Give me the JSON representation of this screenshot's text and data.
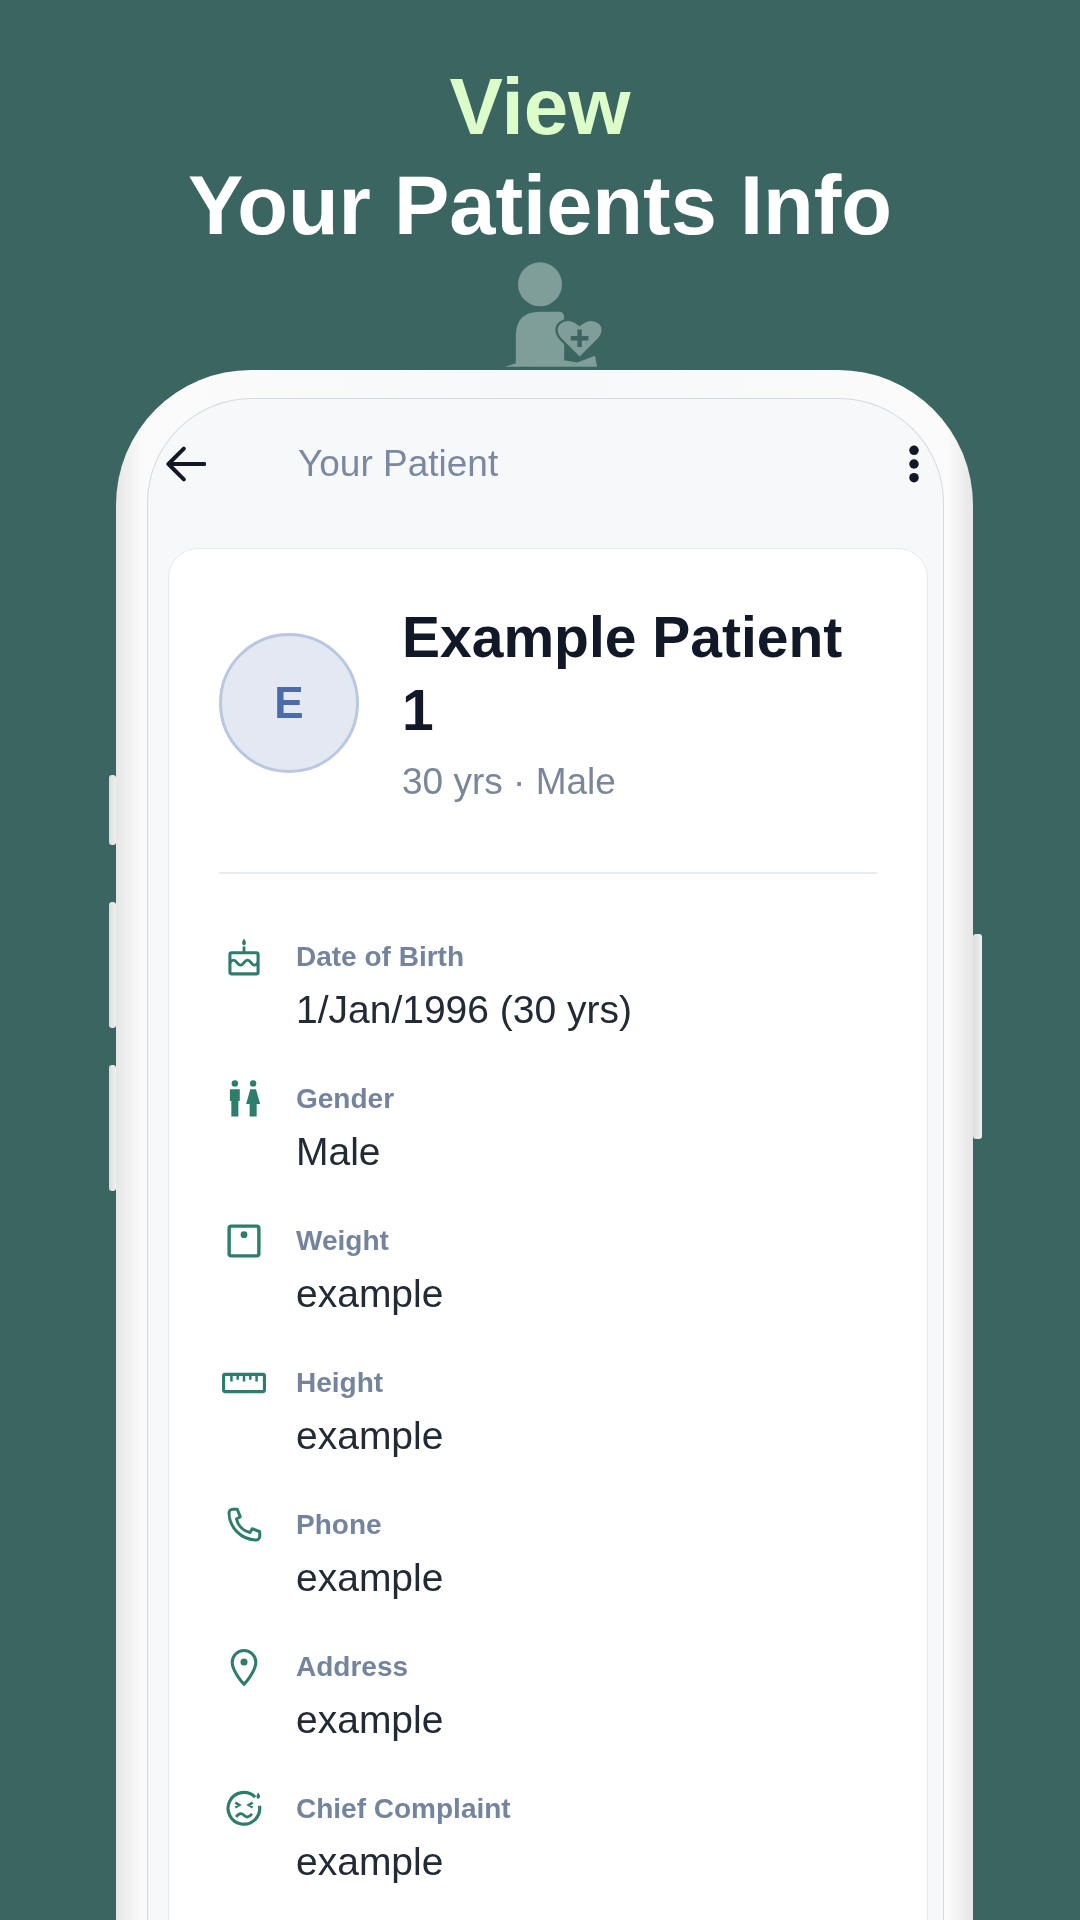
{
  "header": {
    "kicker": "View",
    "title": "Your Patients Info"
  },
  "app_bar": {
    "title": "Your Patient"
  },
  "patient": {
    "initial": "E",
    "name": "Example Patient 1",
    "summary": "30 yrs · Male"
  },
  "details": [
    {
      "kind": "birthday",
      "label": "Date of Birth",
      "value": "1/Jan/1996 (30 yrs)"
    },
    {
      "kind": "gender",
      "label": "Gender",
      "value": "Male"
    },
    {
      "kind": "weight",
      "label": "Weight",
      "value": "example"
    },
    {
      "kind": "height",
      "label": "Height",
      "value": "example"
    },
    {
      "kind": "phone",
      "label": "Phone",
      "value": "example"
    },
    {
      "kind": "address",
      "label": "Address",
      "value": "example"
    },
    {
      "kind": "complaint",
      "label": "Chief Complaint",
      "value": "example"
    }
  ]
}
